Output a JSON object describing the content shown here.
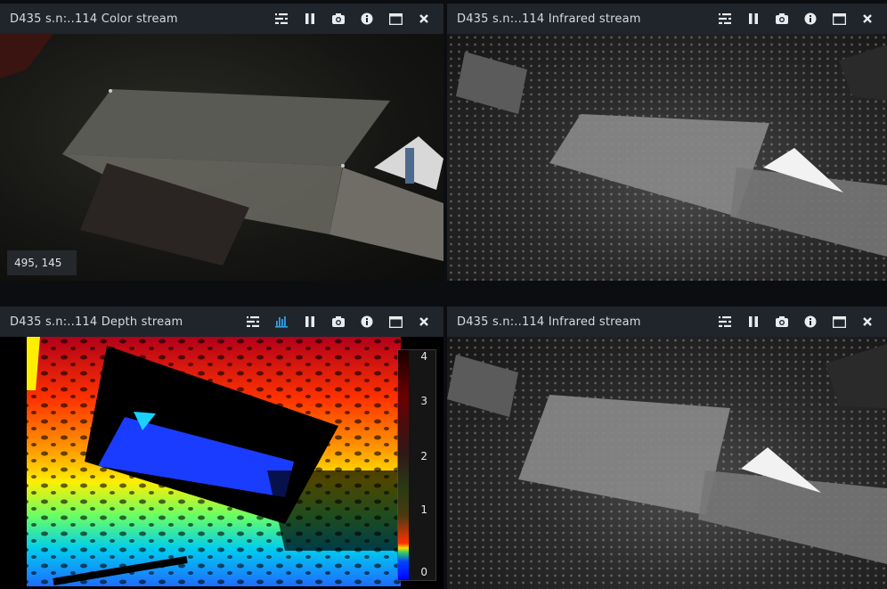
{
  "panels": {
    "color": {
      "title": "D435 s.n:..114 Color stream",
      "coord_readout": "495, 145"
    },
    "ir1": {
      "title": "D435 s.n:..114 Infrared stream"
    },
    "depth": {
      "title": "D435 s.n:..114 Depth stream",
      "colorbar": {
        "ticks": [
          "4",
          "3",
          "2",
          "1",
          "0"
        ],
        "tick_values": [
          4,
          3,
          2,
          1,
          0
        ],
        "min": 0,
        "max": 4
      }
    },
    "ir2": {
      "title": "D435 s.n:..114 Infrared stream"
    }
  },
  "toolbar_icons": {
    "standard": [
      "settings-icon",
      "pause-icon",
      "camera-icon",
      "info-icon",
      "maximize-icon",
      "close-icon"
    ],
    "depth": [
      "settings-icon",
      "histogram-icon",
      "pause-icon",
      "camera-icon",
      "info-icon",
      "maximize-icon",
      "close-icon"
    ]
  },
  "colors": {
    "titlebar_bg": "#1f252b",
    "title_text": "#d7dbe0",
    "icon_white": "#e9ecef",
    "icon_active_blue": "#2f9fe6",
    "app_bg": "#0b0d10"
  }
}
